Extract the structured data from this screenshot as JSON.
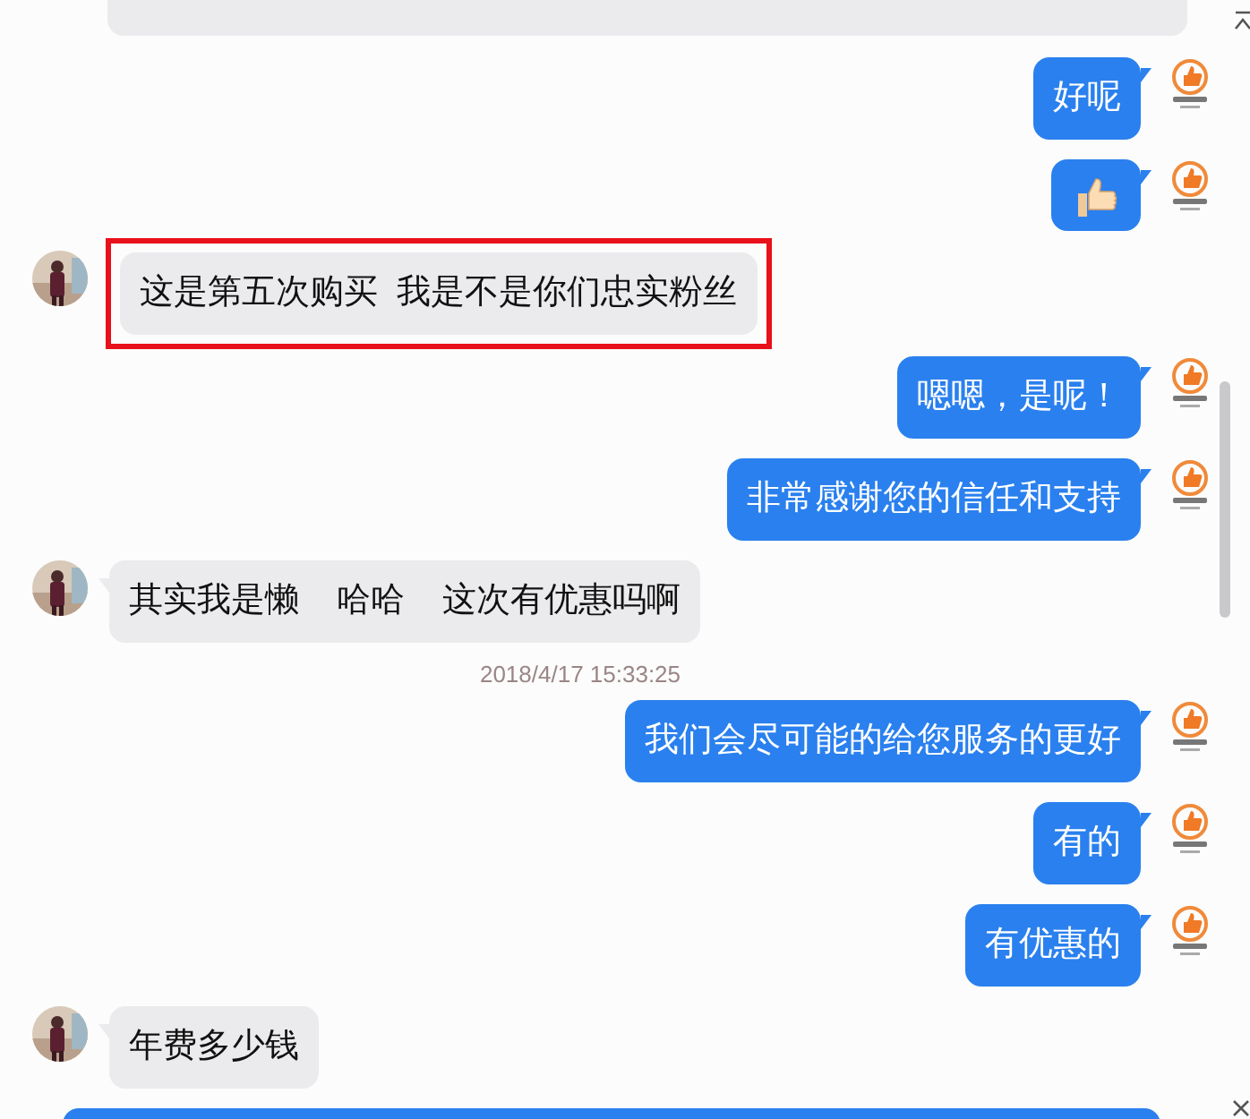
{
  "messages": [
    {
      "kind": "customer_clipped"
    },
    {
      "kind": "seller_text",
      "text": "好呢"
    },
    {
      "kind": "seller_thumb"
    },
    {
      "kind": "customer_text",
      "text": "这是第五次购买  我是不是你们忠实粉丝",
      "highlighted": true
    },
    {
      "kind": "seller_text",
      "text": "嗯嗯，是呢！"
    },
    {
      "kind": "seller_text",
      "text": "非常感谢您的信任和支持"
    },
    {
      "kind": "customer_text",
      "text": "其实我是懒    哈哈    这次有优惠吗啊"
    },
    {
      "kind": "timestamp",
      "text": "2018/4/17 15:33:25"
    },
    {
      "kind": "seller_text",
      "text": "我们会尽可能的给您服务的更好"
    },
    {
      "kind": "seller_text",
      "text": "有的"
    },
    {
      "kind": "seller_text",
      "text": "有优惠的"
    },
    {
      "kind": "customer_text",
      "text": "年费多少钱"
    },
    {
      "kind": "seller_clipped"
    }
  ]
}
